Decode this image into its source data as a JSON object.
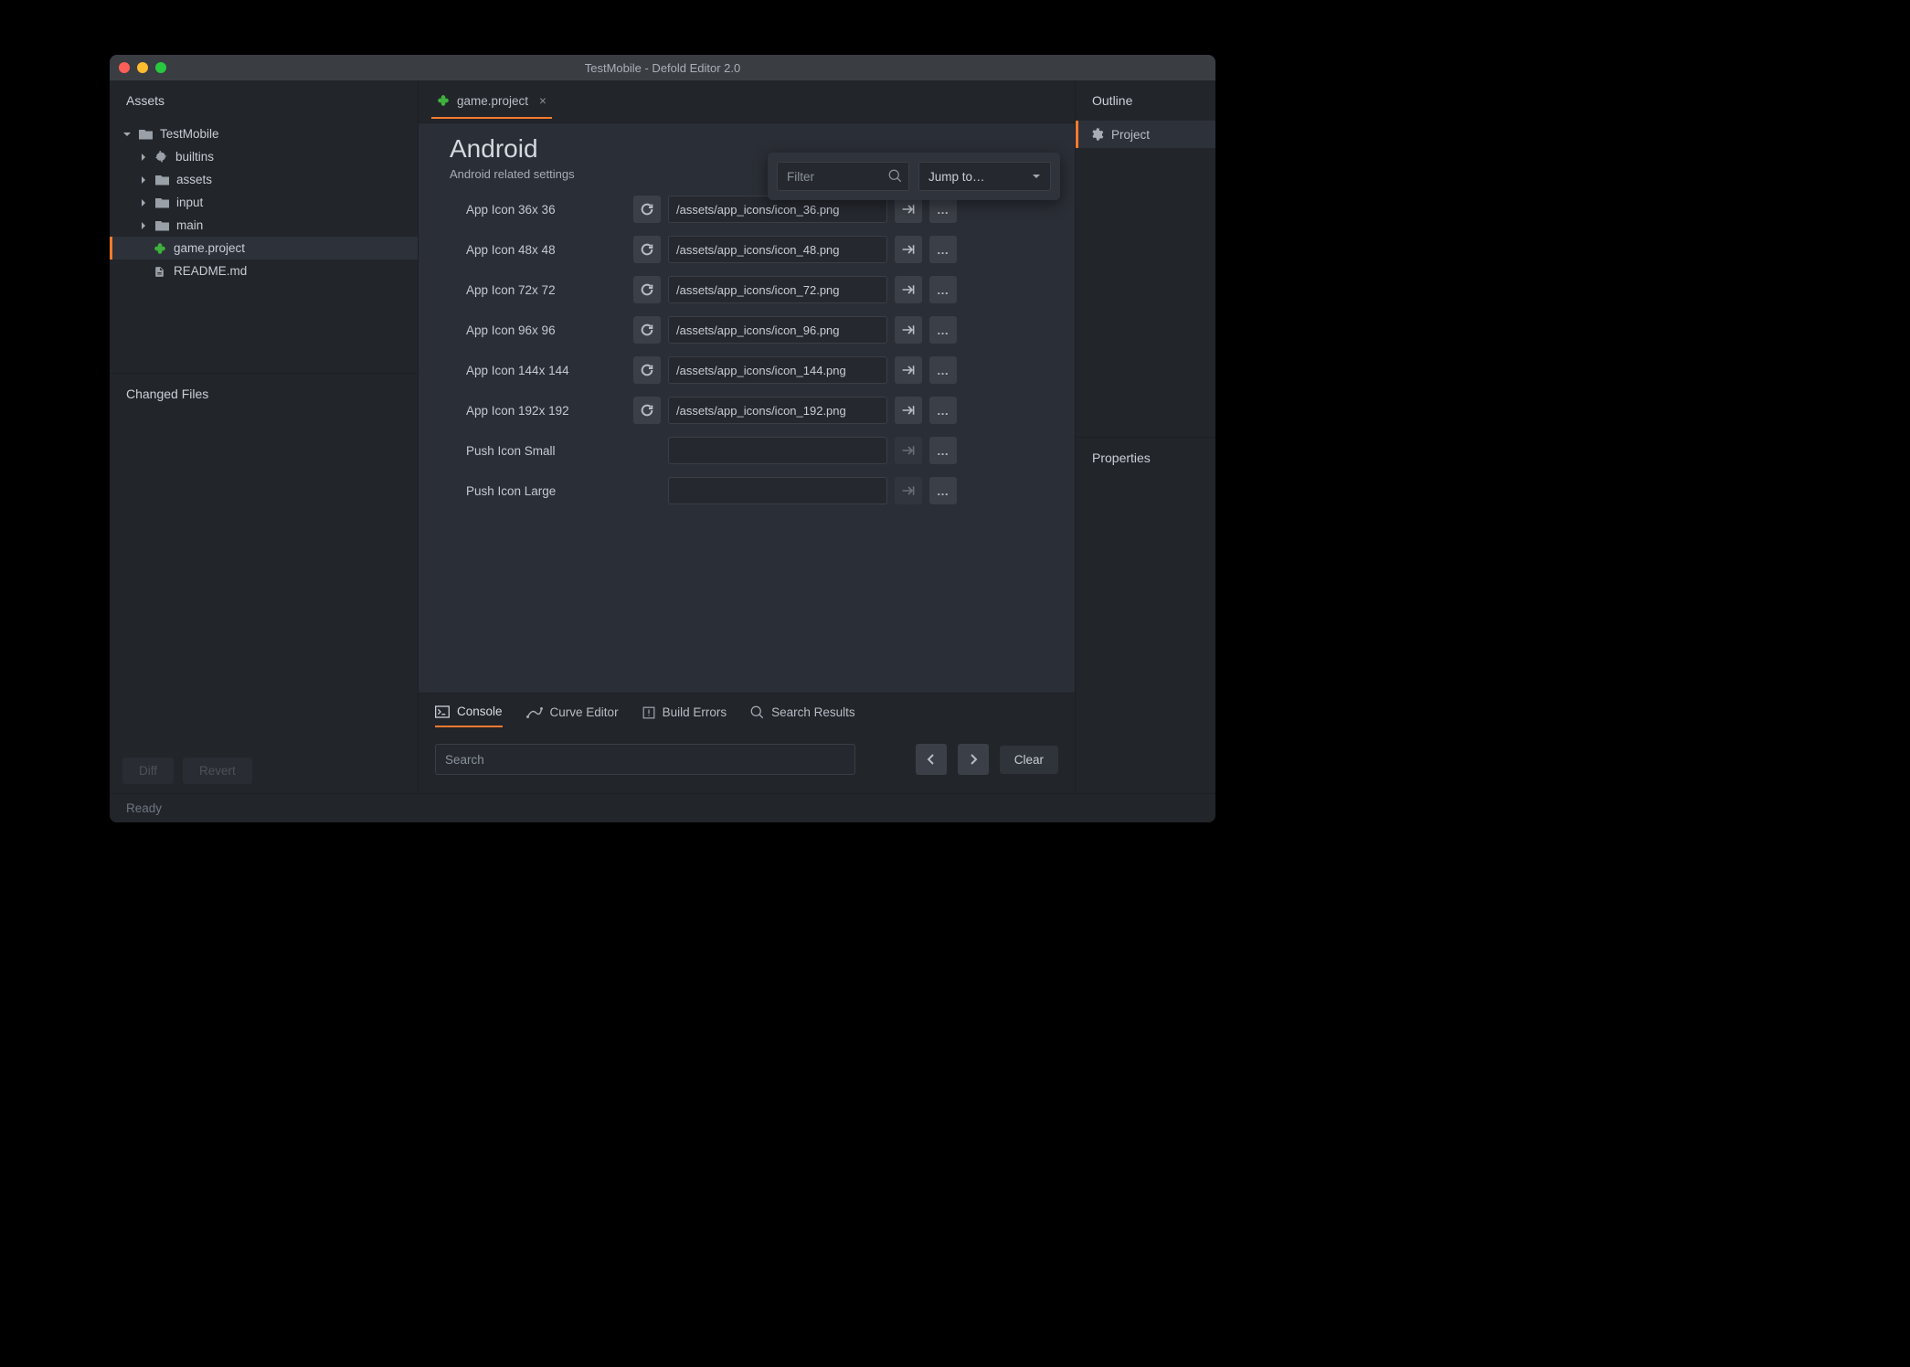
{
  "window": {
    "title": "TestMobile - Defold Editor 2.0"
  },
  "assets": {
    "title": "Assets",
    "tree": [
      {
        "label": "TestMobile",
        "icon": "folder",
        "expanded": true,
        "indent": 0
      },
      {
        "label": "builtins",
        "icon": "puzzle",
        "expanded": false,
        "indent": 1
      },
      {
        "label": "assets",
        "icon": "folder",
        "expanded": false,
        "indent": 1
      },
      {
        "label": "input",
        "icon": "folder",
        "expanded": false,
        "indent": 1
      },
      {
        "label": "main",
        "icon": "folder",
        "expanded": false,
        "indent": 1
      },
      {
        "label": "game.project",
        "icon": "clover",
        "selected": true,
        "indent": 2
      },
      {
        "label": "README.md",
        "icon": "file",
        "indent": 2
      }
    ]
  },
  "changed": {
    "title": "Changed Files",
    "diff_label": "Diff",
    "revert_label": "Revert"
  },
  "tab": {
    "label": "game.project"
  },
  "editor": {
    "section_title": "Android",
    "section_subtitle": "Android related settings",
    "filter_placeholder": "Filter",
    "jumpto_label": "Jump to…",
    "props": [
      {
        "label": "App Icon 36x 36",
        "value": "/assets/app_icons/icon_36.png",
        "reset": true
      },
      {
        "label": "App Icon 48x 48",
        "value": "/assets/app_icons/icon_48.png",
        "reset": true
      },
      {
        "label": "App Icon 72x 72",
        "value": "/assets/app_icons/icon_72.png",
        "reset": true
      },
      {
        "label": "App Icon 96x 96",
        "value": "/assets/app_icons/icon_96.png",
        "reset": true
      },
      {
        "label": "App Icon 144x 144",
        "value": "/assets/app_icons/icon_144.png",
        "reset": true
      },
      {
        "label": "App Icon 192x 192",
        "value": "/assets/app_icons/icon_192.png",
        "reset": true
      },
      {
        "label": "Push Icon Small",
        "value": "",
        "reset": false
      },
      {
        "label": "Push Icon Large",
        "value": "",
        "reset": false
      }
    ]
  },
  "dock": {
    "tabs": [
      {
        "label": "Console",
        "icon": "console",
        "active": true
      },
      {
        "label": "Curve Editor",
        "icon": "curve"
      },
      {
        "label": "Build Errors",
        "icon": "error"
      },
      {
        "label": "Search Results",
        "icon": "search"
      }
    ],
    "search_placeholder": "Search",
    "clear_label": "Clear"
  },
  "outline": {
    "title": "Outline",
    "item": "Project"
  },
  "properties": {
    "title": "Properties"
  },
  "status": {
    "text": "Ready"
  }
}
